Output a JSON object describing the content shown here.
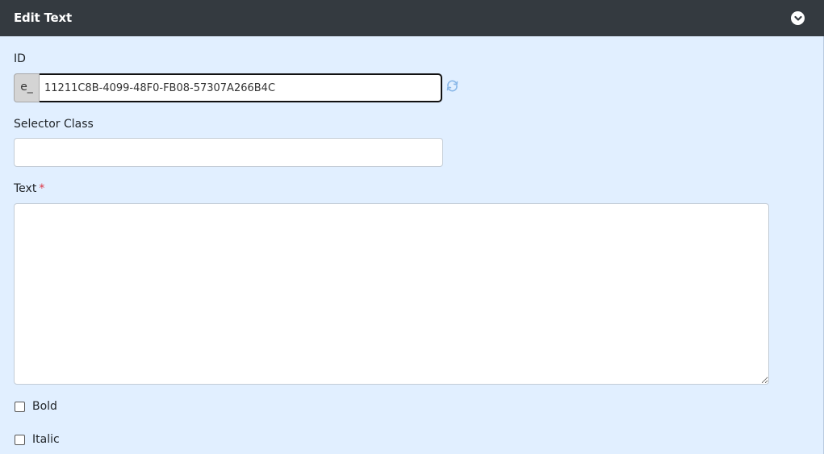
{
  "panel": {
    "title": "Edit Text",
    "toggle_icon": "chevron-down-circle-icon"
  },
  "fields": {
    "id": {
      "label": "ID",
      "prefix": "e_",
      "value": "11211C8B-4099-48F0-FB08-57307A266B4C",
      "refresh_icon": "refresh-icon"
    },
    "selector_class": {
      "label": "Selector Class",
      "value": ""
    },
    "text": {
      "label": "Text",
      "required_mark": "*",
      "value": ""
    }
  },
  "options": {
    "bold_label": "Bold",
    "italic_label": "Italic",
    "bold_checked": false,
    "italic_checked": false
  },
  "colors": {
    "header_bg": "#343a40",
    "body_bg": "#e1efff",
    "required": "#dc3545"
  }
}
